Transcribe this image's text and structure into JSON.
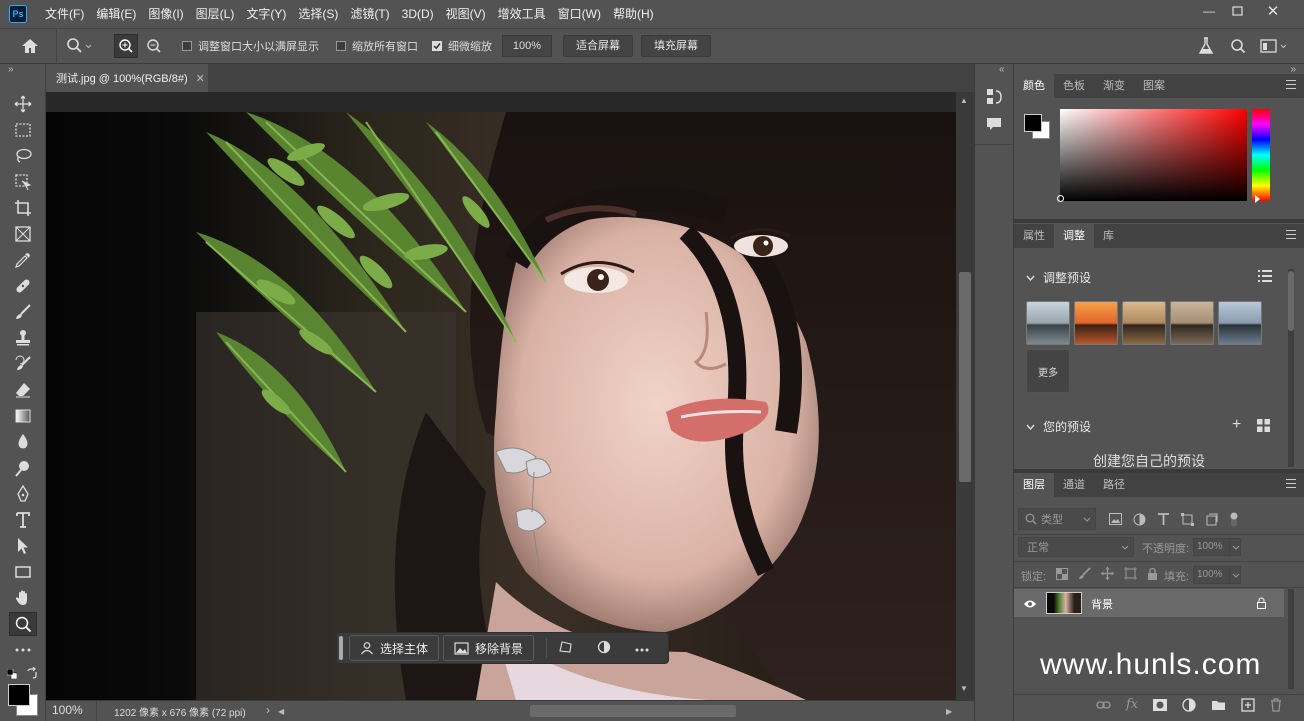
{
  "app": {
    "logo": "Ps"
  },
  "menu": [
    "文件(F)",
    "编辑(E)",
    "图像(I)",
    "图层(L)",
    "文字(Y)",
    "选择(S)",
    "滤镜(T)",
    "3D(D)",
    "视图(V)",
    "增效工具",
    "窗口(W)",
    "帮助(H)"
  ],
  "options": {
    "resize_windows": "调整窗口大小以满屏显示",
    "zoom_all": "缩放所有窗口",
    "scrubby_zoom": "细微缩放",
    "zoom_value": "100%",
    "fit_screen": "适合屏幕",
    "fill_screen": "填充屏幕"
  },
  "document": {
    "tab_title": "测试.jpg @ 100%(RGB/8#)",
    "zoom": "100%",
    "info": "1202 像素 x 676 像素 (72 ppi)"
  },
  "context_bar": {
    "select_subject": "选择主体",
    "remove_bg": "移除背景"
  },
  "color_panel": {
    "tabs": [
      "颜色",
      "色板",
      "渐变",
      "图案"
    ],
    "active": "颜色"
  },
  "adjust_panel": {
    "tabs": [
      "属性",
      "调整",
      "库"
    ],
    "active": "调整",
    "presets_title": "调整预设",
    "more": "更多",
    "your_presets": "您的预设",
    "create_own": "创建您自己的预设"
  },
  "layers_panel": {
    "tabs": [
      "图层",
      "通道",
      "路径"
    ],
    "active": "图层",
    "kind": "类型",
    "blend_mode": "正常",
    "opacity_label": "不透明度:",
    "opacity": "100%",
    "lock_label": "锁定:",
    "fill_label": "填充:",
    "fill": "100%",
    "layer_name": "背景"
  },
  "watermark": "www.hunls.com",
  "colors": {
    "accent": "#31a8ff",
    "panel": "#535353",
    "dark": "#424242"
  }
}
